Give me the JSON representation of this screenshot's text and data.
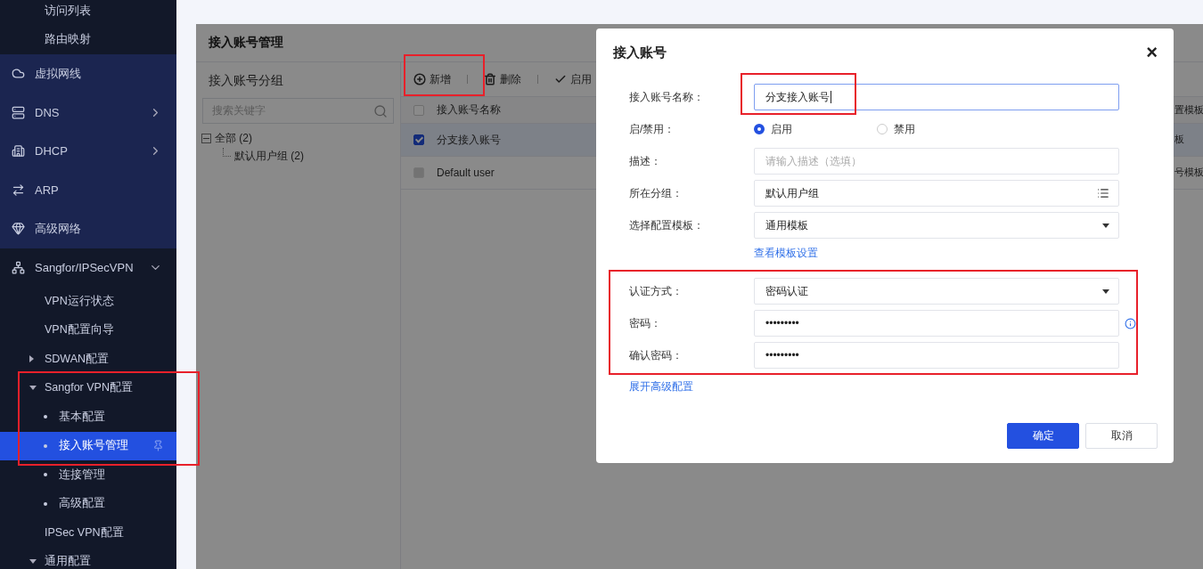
{
  "sidebar": {
    "items": [
      {
        "kind": "item",
        "label": "访问列表",
        "selected": false
      },
      {
        "kind": "item",
        "label": "路由映射",
        "selected": false
      },
      {
        "kind": "section",
        "label": "虚拟网线",
        "selected": false
      },
      {
        "kind": "section",
        "label": "DNS",
        "expanded": false,
        "selected": false
      },
      {
        "kind": "section",
        "label": "DHCP",
        "expanded": false,
        "selected": false
      },
      {
        "kind": "section",
        "label": "ARP",
        "selected": false
      },
      {
        "kind": "section",
        "label": "高级网络",
        "selected": false
      },
      {
        "kind": "section",
        "label": "Sangfor/IPSecVPN",
        "expanded": true,
        "selected": false,
        "children": [
          {
            "kind": "item",
            "label": "VPN运行状态",
            "selected": false
          },
          {
            "kind": "item",
            "label": "VPN配置向导",
            "selected": false
          },
          {
            "kind": "item",
            "label": "SDWAN配置",
            "expanded": false,
            "selected": false
          },
          {
            "kind": "item",
            "label": "Sangfor VPN配置",
            "expanded": true,
            "selected": false,
            "children": [
              {
                "kind": "leaf",
                "label": "基本配置",
                "selected": false
              },
              {
                "kind": "leaf",
                "label": "接入账号管理",
                "selected": true
              },
              {
                "kind": "leaf",
                "label": "连接管理",
                "selected": false
              },
              {
                "kind": "leaf",
                "label": "高级配置",
                "selected": false
              }
            ]
          },
          {
            "kind": "item",
            "label": "IPSec VPN配置",
            "selected": false
          },
          {
            "kind": "item",
            "label": "通用配置",
            "expanded": true,
            "selected": false
          }
        ]
      }
    ]
  },
  "panel": {
    "title": "接入账号管理",
    "groups": {
      "title": "接入账号分组",
      "search_placeholder": "搜索关键字",
      "tree": [
        {
          "label": "全部 (2)",
          "expanded": true,
          "children": [
            {
              "label": "默认用户组 (2)"
            }
          ]
        }
      ]
    },
    "toolbar": [
      {
        "label": "新增"
      },
      {
        "label": "删除"
      },
      {
        "label": "启用"
      }
    ],
    "table": {
      "header_checked": false,
      "columns": [
        "接入账号名称",
        "置模板"
      ],
      "rows": [
        {
          "selected": true,
          "checked": true,
          "disabled": false,
          "cells": [
            "分支接入账号",
            "板"
          ]
        },
        {
          "selected": false,
          "checked": false,
          "disabled": true,
          "cells": [
            "Default user",
            "号模板"
          ]
        }
      ]
    }
  },
  "dialog": {
    "title": "接入账号",
    "close": "×",
    "fields": [
      {
        "kind": "text",
        "label": "接入账号名称：",
        "value": "分支接入账号",
        "focused": true
      },
      {
        "kind": "radio",
        "label": "启/禁用：",
        "options": [
          {
            "label": "启用",
            "selected": true
          },
          {
            "label": "禁用",
            "selected": false
          }
        ]
      },
      {
        "kind": "text",
        "label": "描述：",
        "placeholder": "请输入描述（选填）",
        "focused": false
      },
      {
        "kind": "picker",
        "label": "所在分组：",
        "value": "默认用户组"
      },
      {
        "kind": "select",
        "label": "选择配置模板：",
        "value": "通用模板"
      },
      {
        "kind": "link",
        "label": "查看模板设置"
      }
    ],
    "auth_fields": [
      {
        "kind": "select",
        "label": "认证方式：",
        "value": "密码认证"
      },
      {
        "kind": "password",
        "label": "密码：",
        "value": "•••••••••",
        "info": true
      },
      {
        "kind": "password",
        "label": "确认密码：",
        "value": "•••••••••",
        "info": false
      }
    ],
    "advanced_link": "展开高级配置",
    "buttons": [
      {
        "label": "确定",
        "primary": true
      },
      {
        "label": "取消",
        "primary": false
      }
    ]
  }
}
